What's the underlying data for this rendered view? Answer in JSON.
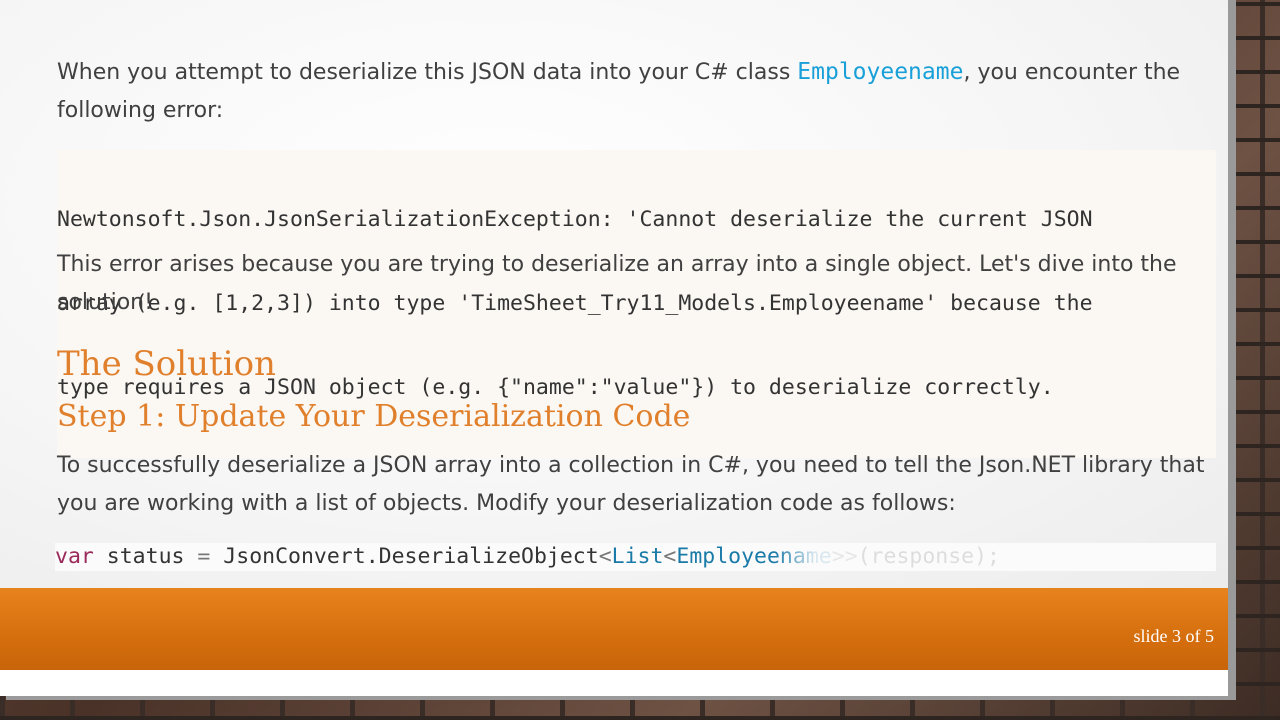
{
  "slide": {
    "para1": {
      "before": "When you attempt to deserialize this JSON data into your C# class ",
      "class_name": "Employeename",
      "after": ", you encounter the following error:"
    },
    "error_lines": [
      "Newtonsoft.Json.JsonSerializationException: 'Cannot deserialize the current JSON",
      "array (e.g. [1,2,3]) into type 'TimeSheet_Try11_Models.Employeename' because the",
      "type requires a JSON object (e.g. {\"name\":\"value\"}) to deserialize correctly."
    ],
    "para2": "This error arises because you are trying to deserialize an array into a single object. Let's dive into the solution!",
    "heading_solution": "The Solution",
    "heading_step1": "Step 1: Update Your Deserialization Code",
    "para3": "To successfully deserialize a JSON array into a collection in C#, you need to tell the Json.NET library that you are working with a list of objects. Modify your deserialization code as follows:",
    "code_tokens": {
      "kw": "var",
      "ident": " status ",
      "eq": "=",
      "call": " JsonConvert.DeserializeObject",
      "lt1": "<",
      "list": "List",
      "lt2": "<",
      "empl": "Employeename",
      "gt": ">>",
      "args": "(response);"
    },
    "slide_number": "slide 3 of 5"
  },
  "colors": {
    "accent_orange": "#e0802c",
    "inline_code_blue": "#1aa0d8",
    "footer_band": "#d7700e"
  }
}
